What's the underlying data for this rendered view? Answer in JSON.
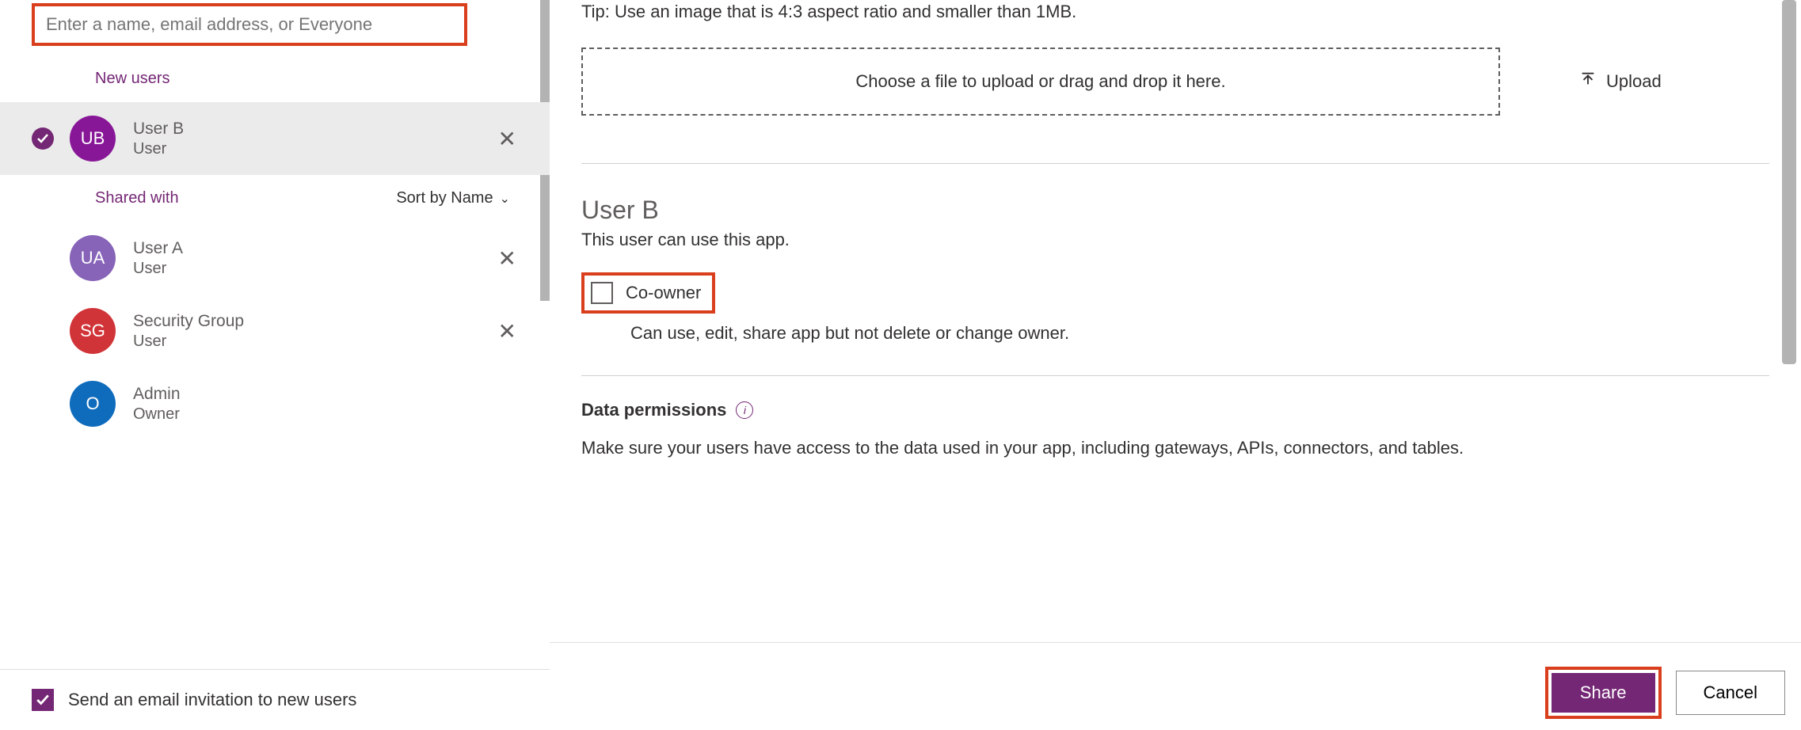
{
  "search": {
    "placeholder": "Enter a name, email address, or Everyone"
  },
  "sections": {
    "newUsers": "New users",
    "sharedWith": "Shared with",
    "sortBy": "Sort by Name"
  },
  "newUserList": [
    {
      "initials": "UB",
      "name": "User B",
      "role": "User"
    }
  ],
  "sharedList": [
    {
      "initials": "UA",
      "name": "User A",
      "role": "User",
      "removable": true,
      "colorClass": "av-purple2"
    },
    {
      "initials": "SG",
      "name": "Security Group",
      "role": "User",
      "removable": true,
      "colorClass": "av-red"
    },
    {
      "initials": "O",
      "name": "Admin",
      "role": "Owner",
      "removable": false,
      "colorClass": "av-blue"
    }
  ],
  "emailInvite": {
    "checked": true,
    "label": "Send an email invitation to new users"
  },
  "imageTip": "Tip: Use an image that is 4:3 aspect ratio and smaller than 1MB.",
  "dropzone": "Choose a file to upload or drag and drop it here.",
  "uploadLabel": "Upload",
  "detail": {
    "title": "User B",
    "subtitle": "This user can use this app.",
    "coownerLabel": "Co-owner",
    "coownerDesc": "Can use, edit, share app but not delete or change owner."
  },
  "dataPermissions": {
    "title": "Data permissions",
    "desc": "Make sure your users have access to the data used in your app, including gateways, APIs, connectors, and tables."
  },
  "buttons": {
    "share": "Share",
    "cancel": "Cancel"
  }
}
